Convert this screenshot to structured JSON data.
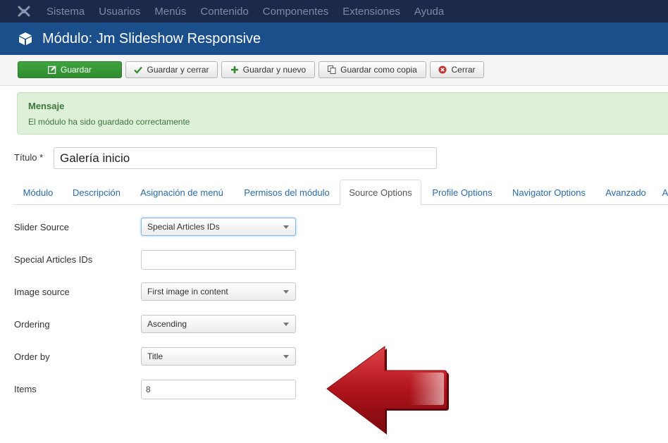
{
  "topnav": {
    "logo_icon": "joomla-icon",
    "items": [
      "Sistema",
      "Usuarios",
      "Menús",
      "Contenido",
      "Componentes",
      "Extensiones",
      "Ayuda"
    ]
  },
  "header": {
    "icon": "cube-icon",
    "title": "Módulo: Jm Slideshow Responsive"
  },
  "toolbar": {
    "save": "Guardar",
    "save_close": "Guardar y cerrar",
    "save_new": "Guardar y nuevo",
    "save_copy": "Guardar como copia",
    "close": "Cerrar"
  },
  "alert": {
    "heading": "Mensaje",
    "text": "El módulo ha sido guardado correctamente"
  },
  "form": {
    "title_label": "Título *",
    "title_value": "Galería inicio"
  },
  "tabs": [
    "Módulo",
    "Descripción",
    "Asignación de menú",
    "Permisos del módulo",
    "Source Options",
    "Profile Options",
    "Navigator Options",
    "Avanzado",
    "A"
  ],
  "active_tab": "Source Options",
  "fields": {
    "slider_source": {
      "label": "Slider Source",
      "value": "Special Articles IDs"
    },
    "special_ids": {
      "label": "Special Articles IDs",
      "value": ""
    },
    "image_source": {
      "label": "Image source",
      "value": "First image in content"
    },
    "ordering": {
      "label": "Ordering",
      "value": "Ascending"
    },
    "order_by": {
      "label": "Order by",
      "value": "Title"
    },
    "items": {
      "label": "Items",
      "value": "8"
    }
  },
  "colors": {
    "topnav_bg": "#1b2a4a",
    "header_bg": "#1a4f8c",
    "primary_button": "#2e8b2e",
    "alert_bg": "#dff0d8",
    "arrow": "#b0141b"
  }
}
